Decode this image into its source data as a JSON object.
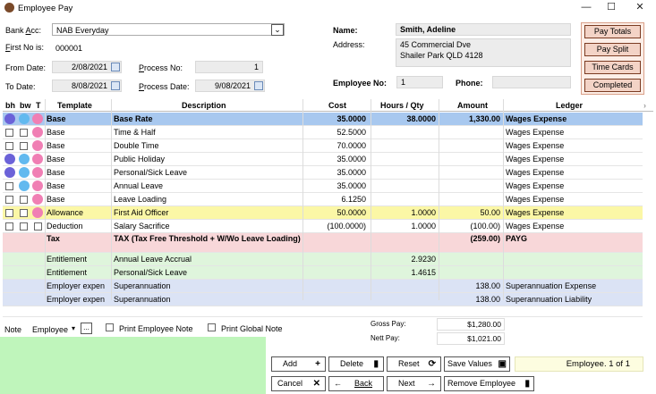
{
  "window": {
    "title": "Employee Pay",
    "minimize": "—",
    "maximize": "☐",
    "close": "✕"
  },
  "header": {
    "bank_acc_label": "Bank Acc:",
    "bank_acc_value": "NAB Everyday",
    "first_no_label": "First No is:",
    "first_no_value": "000001",
    "from_date_label": "From Date:",
    "from_date_value": "2/08/2021",
    "to_date_label": "To Date:",
    "to_date_value": "8/08/2021",
    "process_no_label": "Process No:",
    "process_no_value": "1",
    "process_date_label": "Process Date:",
    "process_date_value": "9/08/2021",
    "name_label": "Name:",
    "name_value": "Smith, Adeline",
    "address_label": "Address:",
    "address_line1": "45 Commercial Dve",
    "address_line2": "Shailer Park QLD 4128",
    "employee_no_label": "Employee No:",
    "employee_no_value": "1",
    "phone_label": "Phone:",
    "phone_value": ""
  },
  "side_buttons": {
    "pay_totals": "Pay Totals",
    "pay_split": "Pay Split",
    "time_cards": "Time Cards",
    "completed": "Completed"
  },
  "columns": {
    "bh": "bh",
    "bw": "bw",
    "t": "T",
    "template": "Template",
    "description": "Description",
    "cost": "Cost",
    "hours": "Hours / Qty",
    "amount": "Amount",
    "ledger": "Ledger"
  },
  "rows": [
    {
      "template": "Base",
      "description": "Base Rate",
      "cost": "35.0000",
      "hours": "38.0000",
      "amount": "1,330.00",
      "ledger": "Wages Expense"
    },
    {
      "template": "Base",
      "description": "Time & Half",
      "cost": "52.5000",
      "hours": "",
      "amount": "",
      "ledger": "Wages Expense"
    },
    {
      "template": "Base",
      "description": "Double Time",
      "cost": "70.0000",
      "hours": "",
      "amount": "",
      "ledger": "Wages Expense"
    },
    {
      "template": "Base",
      "description": "Public Holiday",
      "cost": "35.0000",
      "hours": "",
      "amount": "",
      "ledger": "Wages Expense"
    },
    {
      "template": "Base",
      "description": "Personal/Sick Leave",
      "cost": "35.0000",
      "hours": "",
      "amount": "",
      "ledger": "Wages Expense"
    },
    {
      "template": "Base",
      "description": "Annual Leave",
      "cost": "35.0000",
      "hours": "",
      "amount": "",
      "ledger": "Wages Expense"
    },
    {
      "template": "Base",
      "description": "Leave Loading",
      "cost": "6.1250",
      "hours": "",
      "amount": "",
      "ledger": "Wages Expense"
    },
    {
      "template": "Allowance",
      "description": "First Aid Officer",
      "cost": "50.0000",
      "hours": "1.0000",
      "amount": "50.00",
      "ledger": "Wages Expense"
    },
    {
      "template": "Deduction",
      "description": "Salary Sacrifice",
      "cost": "(100.0000)",
      "hours": "1.0000",
      "amount": "(100.00)",
      "ledger": "Wages Expense"
    },
    {
      "template": "Tax",
      "description": "TAX (Tax Free Threshold + W/Wo Leave Loading)",
      "cost": "",
      "hours": "",
      "amount": "(259.00)",
      "ledger": "PAYG"
    },
    {
      "template": "Entitlement",
      "description": "Annual Leave Accrual",
      "cost": "",
      "hours": "2.9230",
      "amount": "",
      "ledger": ""
    },
    {
      "template": "Entitlement",
      "description": "Personal/Sick Leave",
      "cost": "",
      "hours": "1.4615",
      "amount": "",
      "ledger": ""
    },
    {
      "template": "Employer expen",
      "description": "Superannuation",
      "cost": "",
      "hours": "",
      "amount": "138.00",
      "ledger": "Superannuation Expense"
    },
    {
      "template": "Employer expen",
      "description": "Superannuation",
      "cost": "",
      "hours": "",
      "amount": "138.00",
      "ledger": "Superannuation Liability"
    }
  ],
  "notes": {
    "note_label": "Note",
    "note_type": "Employee",
    "ellipsis": "...",
    "print_employee_note": "Print Employee Note",
    "print_global_note": "Print Global Note"
  },
  "totals": {
    "gross_label": "Gross Pay:",
    "gross_value": "$1,280.00",
    "nett_label": "Nett Pay:",
    "nett_value": "$1,021.00"
  },
  "buttons": {
    "add": "Add",
    "delete": "Delete",
    "reset": "Reset",
    "save_values": "Save Values",
    "cancel": "Cancel",
    "back": "Back",
    "next": "Next",
    "remove_employee": "Remove Employee"
  },
  "status": {
    "employee_count": "Employee. 1 of 1"
  },
  "colors": {
    "selected_row": "#a8c8ef",
    "allowance_row": "#fbf7a6",
    "tax_row": "#f8d7d9",
    "entitlement_row": "#dff5dc",
    "employer_row": "#dbe3f5",
    "note_area": "#bff5bb"
  }
}
